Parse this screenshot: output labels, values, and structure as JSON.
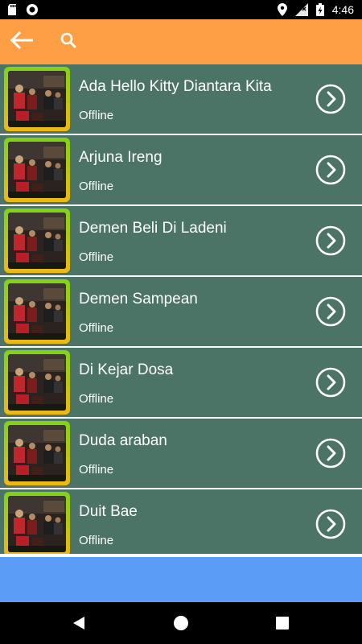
{
  "status_bar": {
    "time": "4:46",
    "icons": [
      "sd-card-icon",
      "circle-notification-icon",
      "location-icon",
      "signal-icon",
      "battery-charging-icon"
    ]
  },
  "colors": {
    "toolbar": "#ff9f45",
    "list_item_bg": "#4c7466",
    "thumb_frame_gradient_top": "#7fd318",
    "thumb_frame_gradient_bottom": "#f1b90f",
    "banner": "#5b9cf7",
    "navbar": "#000000"
  },
  "toolbar": {
    "back_icon": "arrow-left-icon",
    "search_icon": "search-icon"
  },
  "songs": [
    {
      "title": "Ada Hello Kitty Diantara Kita",
      "status": "Offline"
    },
    {
      "title": "Arjuna Ireng",
      "status": "Offline"
    },
    {
      "title": "Demen Beli Di Ladeni",
      "status": "Offline"
    },
    {
      "title": "Demen Sampean",
      "status": "Offline"
    },
    {
      "title": "Di Kejar Dosa",
      "status": "Offline"
    },
    {
      "title": "Duda araban",
      "status": "Offline"
    },
    {
      "title": "Duit Bae",
      "status": "Offline"
    }
  ],
  "navbar": {
    "icons": [
      "nav-back-icon",
      "nav-home-icon",
      "nav-recent-icon"
    ]
  }
}
